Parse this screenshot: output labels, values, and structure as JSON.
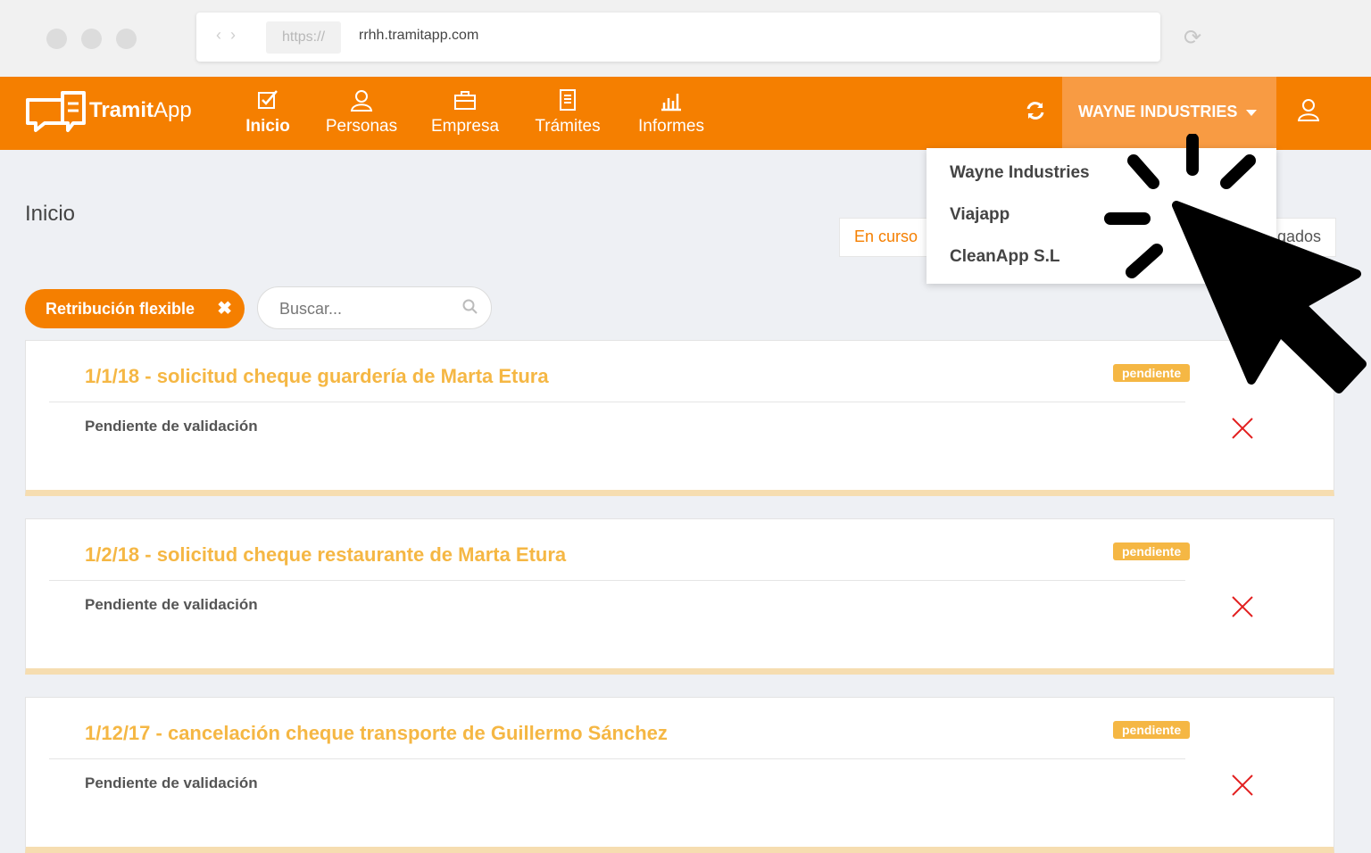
{
  "browser": {
    "protocol": "https://",
    "url": "rrhh.tramitapp.com"
  },
  "brand": {
    "name_part1": "Tramit",
    "name_part2": "App",
    "accent": "#f57f00"
  },
  "nav": [
    {
      "label": "Inicio",
      "icon": "checkbox-icon",
      "active": true
    },
    {
      "label": "Personas",
      "icon": "person-icon"
    },
    {
      "label": "Empresa",
      "icon": "briefcase-icon"
    },
    {
      "label": "Trámites",
      "icon": "document-icon"
    },
    {
      "label": "Informes",
      "icon": "bar-chart-icon"
    }
  ],
  "header": {
    "company": "WAYNE INDUSTRIES"
  },
  "company_menu": {
    "items": [
      "Wayne Industries",
      "Viajapp",
      "CleanApp S.L"
    ]
  },
  "page": {
    "title": "Inicio"
  },
  "tabs": {
    "active": "En curso",
    "other_partial": "gados"
  },
  "filters": {
    "chip": "Retribución flexible",
    "search_placeholder": "Buscar..."
  },
  "cards": [
    {
      "title": "1/1/18 - solicitud cheque guardería de Marta Etura",
      "status": "Pendiente de validación",
      "badge": "pendiente"
    },
    {
      "title": "1/2/18 - solicitud cheque restaurante de Marta Etura",
      "status": "Pendiente de validación",
      "badge": "pendiente"
    },
    {
      "title": "1/12/17 - cancelación cheque transporte de Guillermo Sánchez",
      "status": "Pendiente de validación",
      "badge": "pendiente"
    }
  ]
}
